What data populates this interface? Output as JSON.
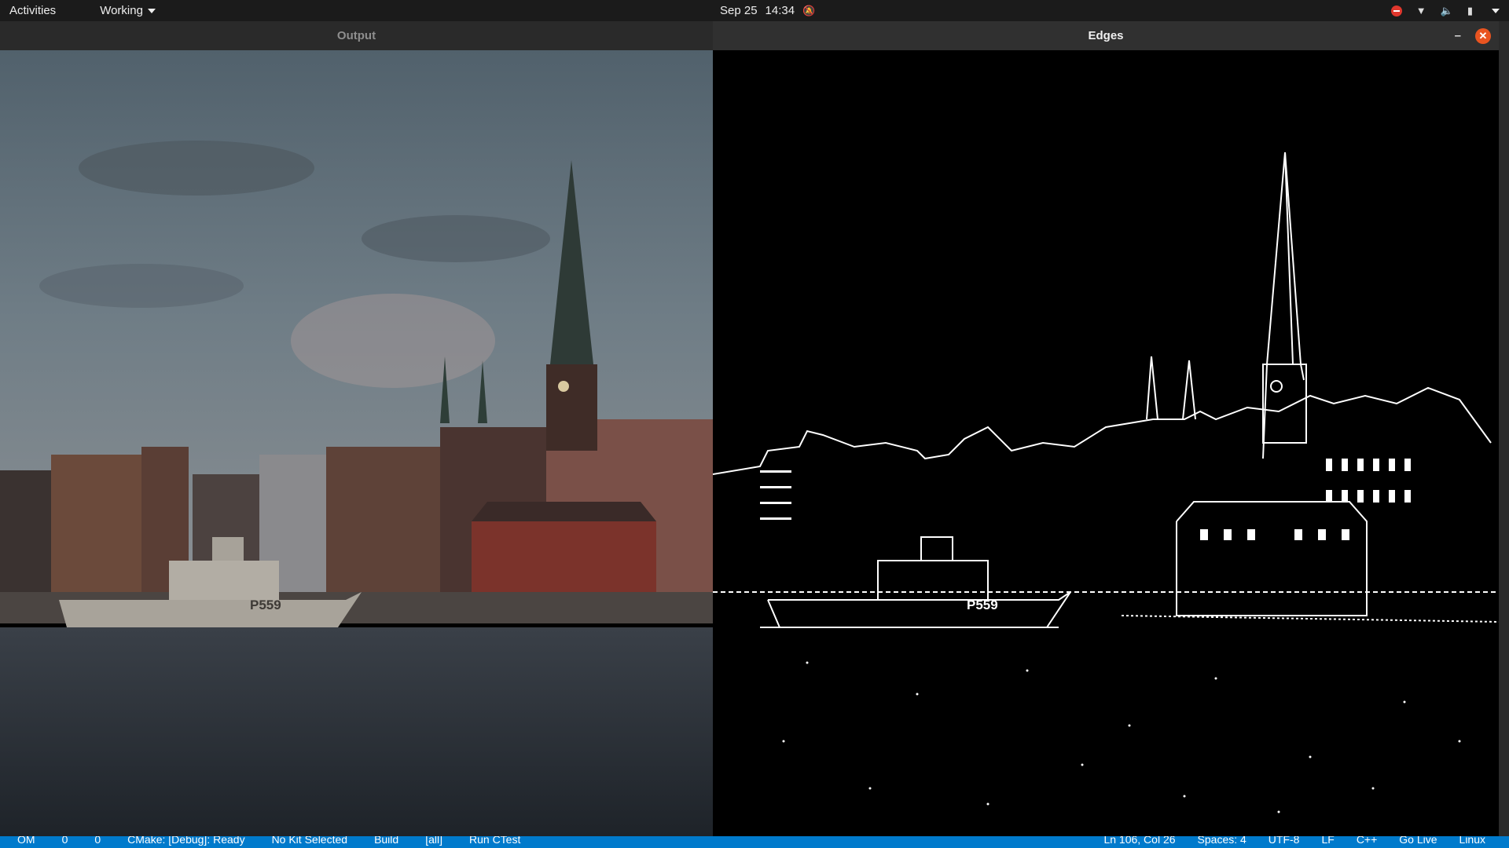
{
  "topbar": {
    "activities": "Activities",
    "app_menu": "Working",
    "date": "Sep 25",
    "time": "14:34",
    "icons": [
      "notifications-muted-icon",
      "dnd-icon",
      "wifi-icon",
      "volume-icon",
      "battery-icon",
      "system-menu-icon"
    ]
  },
  "windows": {
    "output": {
      "title": "Output",
      "ship_label": "P559"
    },
    "edges": {
      "title": "Edges",
      "minimize": "–",
      "close": "✕",
      "ship_label": "P559"
    }
  },
  "statusbar": {
    "left": [
      "OM",
      "0",
      "0",
      "CMake: [Debug]: Ready",
      "No Kit Selected",
      "Build",
      "[all]",
      "Run CTest"
    ],
    "right": [
      "Ln 106, Col 26",
      "Spaces: 4",
      "UTF-8",
      "LF",
      "C++",
      "Go Live",
      "Linux"
    ]
  },
  "colors": {
    "statusbar": "#007acc",
    "close_button": "#e95420"
  }
}
